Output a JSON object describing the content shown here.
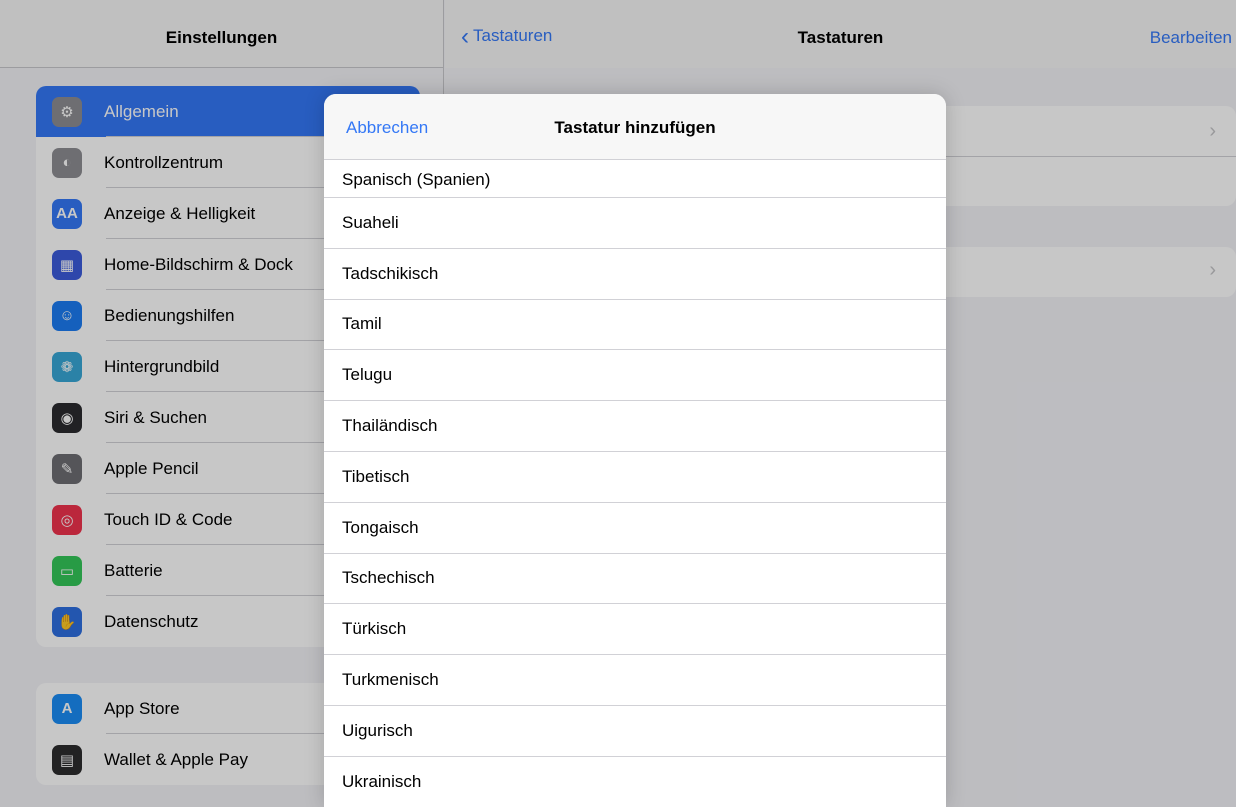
{
  "sidebar": {
    "title": "Einstellungen",
    "items_group1": [
      {
        "label": "Allgemein",
        "icon": "gear-icon",
        "color": "#8e8e93",
        "glyph": "⚙"
      },
      {
        "label": "Kontrollzentrum",
        "icon": "toggle-icon",
        "color": "#8e8e93",
        "glyph": "◐"
      },
      {
        "label": "Anzeige & Helligkeit",
        "icon": "text-size-icon",
        "color": "#3478f6",
        "glyph": "AA"
      },
      {
        "label": "Home-Bildschirm & Dock",
        "icon": "grid-icon",
        "color": "#3b5bdb",
        "glyph": "▦"
      },
      {
        "label": "Bedienungshilfen",
        "icon": "accessibility-icon",
        "color": "#1c7cf2",
        "glyph": "☺"
      },
      {
        "label": "Hintergrundbild",
        "icon": "flower-icon",
        "color": "#38a7d6",
        "glyph": "❁"
      },
      {
        "label": "Siri & Suchen",
        "icon": "siri-icon",
        "color": "#2b2b2f",
        "glyph": "◉"
      },
      {
        "label": "Apple Pencil",
        "icon": "pencil-icon",
        "color": "#6e6e73",
        "glyph": "✎"
      },
      {
        "label": "Touch ID & Code",
        "icon": "fingerprint-icon",
        "color": "#f0334d",
        "glyph": "◎"
      },
      {
        "label": "Batterie",
        "icon": "battery-icon",
        "color": "#34c759",
        "glyph": "▭"
      },
      {
        "label": "Datenschutz",
        "icon": "hand-icon",
        "color": "#2d6fe0",
        "glyph": "✋"
      }
    ],
    "items_group2": [
      {
        "label": "App Store",
        "icon": "app-store-icon",
        "color": "#1a8cf5",
        "glyph": "A"
      },
      {
        "label": "Wallet & Apple Pay",
        "icon": "wallet-icon",
        "color": "#2c2c2e",
        "glyph": "▤"
      }
    ]
  },
  "detail": {
    "back_label": "Tastaturen",
    "title": "Tastaturen",
    "edit_label": "Bearbeiten"
  },
  "sheet": {
    "cancel_label": "Abbrechen",
    "title": "Tastatur hinzufügen",
    "languages": [
      "Spanisch (Spanien)",
      "Suaheli",
      "Tadschikisch",
      "Tamil",
      "Telugu",
      "Thailändisch",
      "Tibetisch",
      "Tongaisch",
      "Tschechisch",
      "Türkisch",
      "Turkmenisch",
      "Uigurisch",
      "Ukrainisch"
    ]
  }
}
